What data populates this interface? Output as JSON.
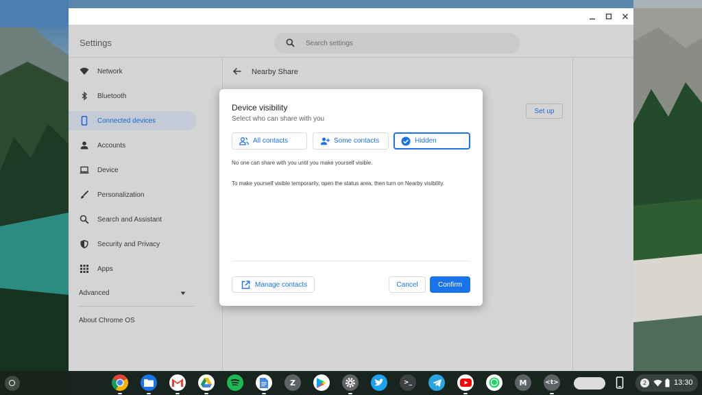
{
  "window": {
    "app_title": "Settings",
    "search_placeholder": "Search settings"
  },
  "sidebar": {
    "items": [
      {
        "label": "Network",
        "icon": "wifi-icon"
      },
      {
        "label": "Bluetooth",
        "icon": "bluetooth-icon"
      },
      {
        "label": "Connected devices",
        "icon": "phone-icon",
        "active": true
      },
      {
        "label": "Accounts",
        "icon": "person-icon"
      },
      {
        "label": "Device",
        "icon": "laptop-icon"
      },
      {
        "label": "Personalization",
        "icon": "brush-icon"
      },
      {
        "label": "Search and Assistant",
        "icon": "search-icon"
      },
      {
        "label": "Security and Privacy",
        "icon": "shield-icon"
      },
      {
        "label": "Apps",
        "icon": "apps-grid-icon"
      }
    ],
    "advanced_label": "Advanced",
    "about_label": "About Chrome OS"
  },
  "content": {
    "page_title": "Nearby Share",
    "setup_label": "Set up"
  },
  "dialog": {
    "title": "Device visibility",
    "subtitle": "Select who can share with you",
    "options": [
      {
        "label": "All contacts",
        "icon": "people-icon"
      },
      {
        "label": "Some contacts",
        "icon": "person-add-icon"
      },
      {
        "label": "Hidden",
        "icon": "check-circle-icon",
        "selected": true
      }
    ],
    "description_1": "No one can share with you until you make yourself visible.",
    "description_2": "To make yourself visible temporarily, open the status area, then turn on Nearby visibility.",
    "manage_contacts_label": "Manage contacts",
    "cancel_label": "Cancel",
    "confirm_label": "Confirm"
  },
  "shelf": {
    "apps": [
      "Chrome",
      "Files",
      "Gmail",
      "Google Drive",
      "Spotify",
      "Google Docs",
      "Z",
      "Play Store",
      "Settings",
      "Twitter",
      "Terminal",
      "Telegram",
      "YouTube",
      "WhatsApp",
      "M",
      "<t>"
    ],
    "zoom_letter": "Z",
    "m_letter": "M",
    "dev_letters": "<t>",
    "terminal_glyph": ">_",
    "notification_count": "2",
    "time": "13:30"
  },
  "colors": {
    "accent": "#1a73e8",
    "selected_nav_bg": "#dbe3f0"
  }
}
